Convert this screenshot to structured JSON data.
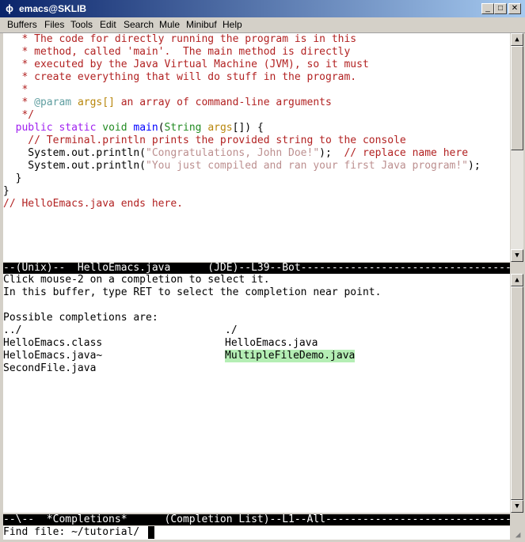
{
  "window": {
    "title": "emacs@SKLIB",
    "icon": "emacs-gnu-icon"
  },
  "menu": [
    "Buffers",
    "Files",
    "Tools",
    "Edit",
    "Search",
    "Mule",
    "Minibuf",
    "Help"
  ],
  "editor": {
    "lines": [
      "   * The code for directly running the program is in this",
      "   * method, called 'main'.  The main method is directly",
      "   * executed by the Java Virtual Machine (JVM), so it must",
      "   * create everything that will do stuff in the program.",
      "   *",
      "   * @param args[] an array of command-line arguments",
      "   */",
      "  public static void main(String args[]) {",
      "    // Terminal.println prints the provided string to the console",
      "    System.out.println(\"Congratulations, John Doe!\");  // replace name here",
      "    System.out.println(\"You just compiled and ran your first Java program!\");",
      "  }",
      "}",
      "// HelloEmacs.java ends here."
    ]
  },
  "modeline_top": "--(Unix)--  HelloEmacs.java      (JDE)--L39--Bot------------------------------------------------",
  "completions": {
    "intro1": "Click mouse-2 on a completion to select it.",
    "intro2": "In this buffer, type RET to select the completion near point.",
    "header": "Possible completions are:",
    "left": [
      "../",
      "HelloEmacs.class",
      "HelloEmacs.java~",
      "SecondFile.java"
    ],
    "right": [
      "./",
      "HelloEmacs.java",
      "MultipleFileDemo.java"
    ],
    "highlighted": "MultipleFileDemo.java"
  },
  "modeline_bottom": "--\\--  *Completions*      (Completion List)--L1--All---------------------------------------------",
  "minibuffer": {
    "prompt": "Find file: ",
    "value": "~/tutorial/"
  },
  "colors": {
    "comment": "#b22222",
    "keyword": "#a020f0",
    "function": "#0000ff",
    "type": "#228b22",
    "string": "#bc8f8f",
    "highlight": "#b4eeb4"
  }
}
